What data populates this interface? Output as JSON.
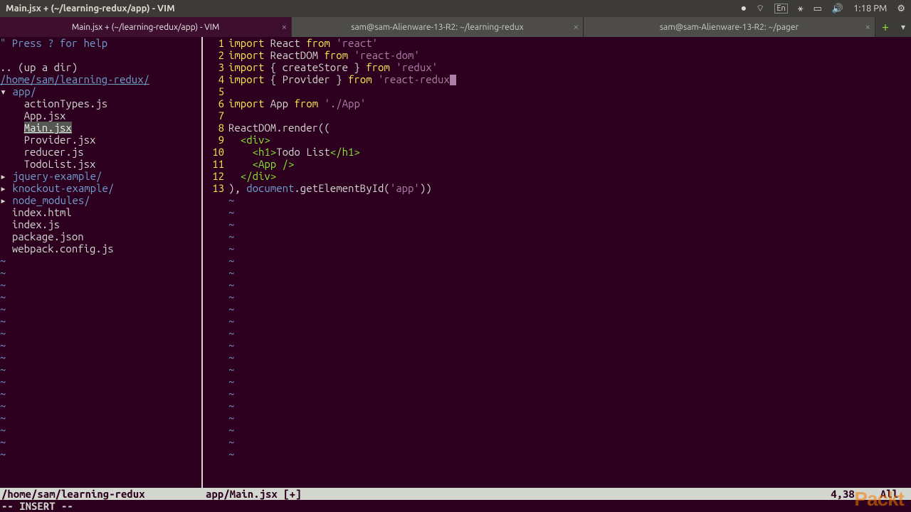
{
  "window": {
    "title": "Main.jsx + (~/learning-redux/app) - VIM"
  },
  "menubar": {
    "lang": "En",
    "time": "1:18 PM"
  },
  "tabs": [
    {
      "label": "Main.jsx + (~/learning-redux/app) - VIM",
      "active": true
    },
    {
      "label": "sam@sam-Alienware-13-R2: ~/learning-redux",
      "active": false
    },
    {
      "label": "sam@sam-Alienware-13-R2: ~/pager",
      "active": false
    }
  ],
  "sidebar": {
    "help": "\" Press ? for help",
    "updir": ".. (up a dir)",
    "root": "/home/sam/learning-redux/",
    "tree": [
      {
        "pre": "▾ ",
        "name": "app/",
        "dir": true
      },
      {
        "pre": "    ",
        "name": "actionTypes.js"
      },
      {
        "pre": "    ",
        "name": "App.jsx"
      },
      {
        "pre": "    ",
        "name": "Main.jsx",
        "sel": true
      },
      {
        "pre": "    ",
        "name": "Provider.jsx"
      },
      {
        "pre": "    ",
        "name": "reducer.js"
      },
      {
        "pre": "    ",
        "name": "TodoList.jsx"
      },
      {
        "pre": "▸ ",
        "name": "jquery-example/",
        "dir": true
      },
      {
        "pre": "▸ ",
        "name": "knockout-example/",
        "dir": true
      },
      {
        "pre": "▸ ",
        "name": "node_modules/",
        "dir": true
      },
      {
        "pre": "  ",
        "name": "index.html"
      },
      {
        "pre": "  ",
        "name": "index.js"
      },
      {
        "pre": "  ",
        "name": "package.json"
      },
      {
        "pre": "  ",
        "name": "webpack.config.js"
      }
    ]
  },
  "code": {
    "lines": [
      {
        "n": 1,
        "t": [
          [
            "kw",
            "import"
          ],
          [
            "id",
            " React "
          ],
          [
            "kw",
            "from"
          ],
          [
            "id",
            " "
          ],
          [
            "str",
            "'react'"
          ]
        ]
      },
      {
        "n": 2,
        "t": [
          [
            "kw",
            "import"
          ],
          [
            "id",
            " ReactDOM "
          ],
          [
            "kw",
            "from"
          ],
          [
            "id",
            " "
          ],
          [
            "str",
            "'react-dom'"
          ]
        ]
      },
      {
        "n": 3,
        "t": [
          [
            "kw",
            "import"
          ],
          [
            "id",
            " { createStore } "
          ],
          [
            "kw",
            "from"
          ],
          [
            "id",
            " "
          ],
          [
            "str",
            "'redux'"
          ]
        ]
      },
      {
        "n": 4,
        "t": [
          [
            "kw",
            "import"
          ],
          [
            "id",
            " { Provider } "
          ],
          [
            "kw",
            "from"
          ],
          [
            "id",
            " "
          ],
          [
            "str",
            "'react-redux"
          ]
        ],
        "cursor": true
      },
      {
        "n": 5,
        "t": []
      },
      {
        "n": 6,
        "t": [
          [
            "kw",
            "import"
          ],
          [
            "id",
            " App "
          ],
          [
            "kw",
            "from"
          ],
          [
            "id",
            " "
          ],
          [
            "str",
            "'./App'"
          ]
        ]
      },
      {
        "n": 7,
        "t": []
      },
      {
        "n": 8,
        "t": [
          [
            "id",
            "ReactDOM.render(("
          ]
        ]
      },
      {
        "n": 9,
        "t": [
          [
            "id",
            "  "
          ],
          [
            "type",
            "<div>"
          ]
        ]
      },
      {
        "n": 10,
        "t": [
          [
            "id",
            "    "
          ],
          [
            "type",
            "<h1>"
          ],
          [
            "id",
            "Todo List"
          ],
          [
            "type",
            "</h1>"
          ]
        ]
      },
      {
        "n": 11,
        "t": [
          [
            "id",
            "    "
          ],
          [
            "type",
            "<App />"
          ]
        ]
      },
      {
        "n": 12,
        "t": [
          [
            "id",
            "  "
          ],
          [
            "type",
            "</div>"
          ]
        ]
      },
      {
        "n": 13,
        "t": [
          [
            "id",
            "), "
          ],
          [
            "doc",
            "document"
          ],
          [
            "id",
            ".getElementById("
          ],
          [
            "str",
            "'app'"
          ],
          [
            "id",
            "))"
          ]
        ]
      }
    ]
  },
  "status": {
    "left": "/home/sam/learning-redux",
    "mid": "app/Main.jsx [+]",
    "pos": "4,38",
    "all": "All"
  },
  "mode": "-- INSERT --",
  "watermark": "Packt"
}
